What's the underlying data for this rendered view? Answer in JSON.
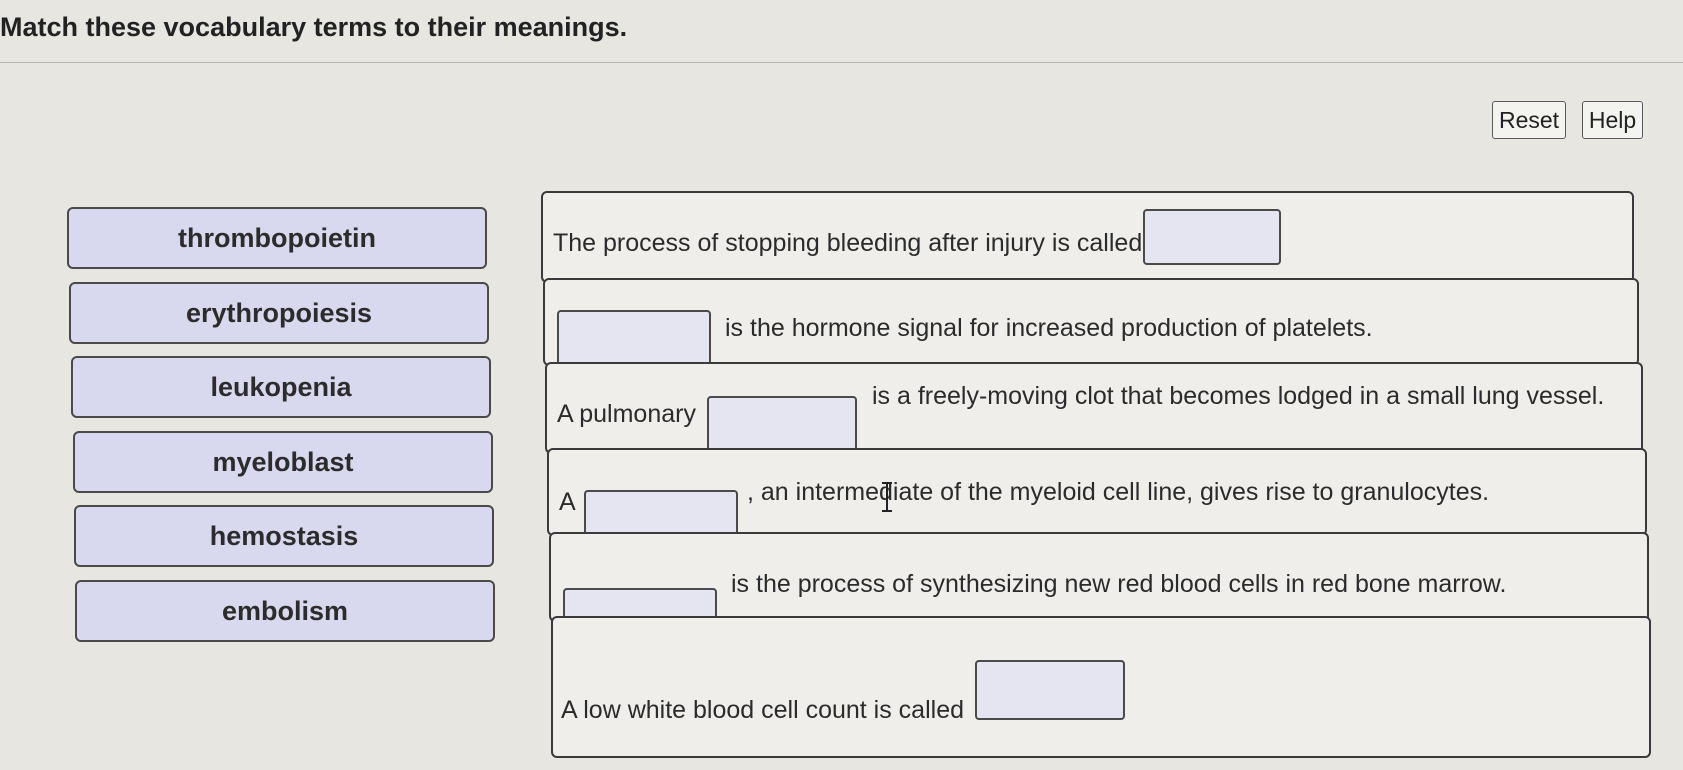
{
  "title": "Match these vocabulary terms to their meanings.",
  "toolbar": {
    "reset_label": "Reset",
    "help_label": "Help"
  },
  "terms": [
    {
      "label": "thrombopoietin"
    },
    {
      "label": "erythropoiesis"
    },
    {
      "label": "leukopenia"
    },
    {
      "label": "myeloblast"
    },
    {
      "label": "hemostasis"
    },
    {
      "label": "embolism"
    }
  ],
  "sentences": [
    {
      "before": "The process of stopping bleeding after injury is called",
      "after": ""
    },
    {
      "before": "",
      "after": "is the hormone signal for increased production of platelets."
    },
    {
      "before": "A pulmonary",
      "after": "is a freely-moving clot that becomes lodged in a small lung vessel."
    },
    {
      "before": "A",
      "after": ", an intermediate of the myeloid cell line, gives rise to granulocytes."
    },
    {
      "before": "",
      "after": "is the process of synthesizing new red blood cells in red bone marrow."
    },
    {
      "before": "A low white blood cell count is called",
      "after": ""
    }
  ]
}
